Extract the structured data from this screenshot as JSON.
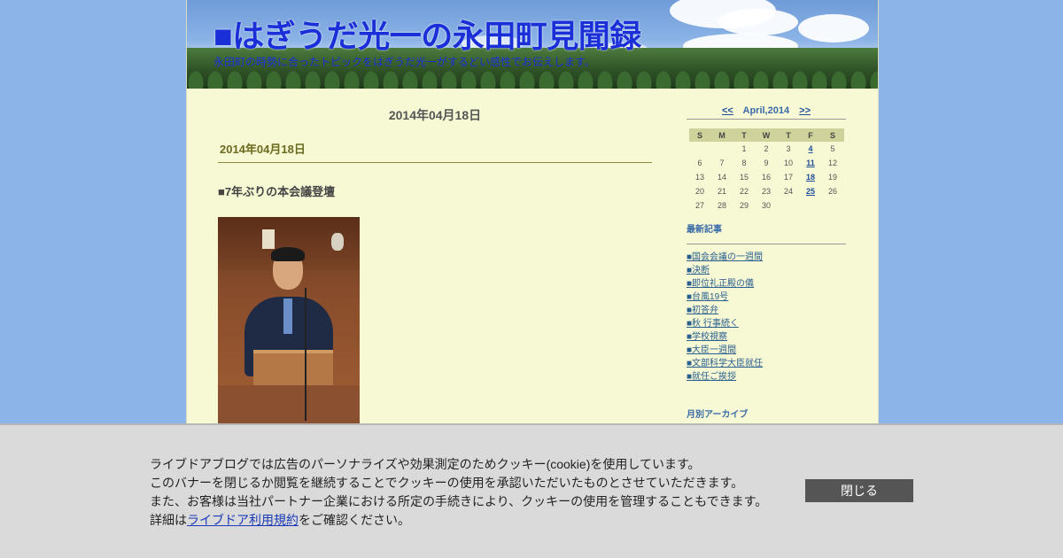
{
  "blog": {
    "title": "■はぎうだ光一の永田町見聞録",
    "description": "永田町の時勢に合ったトピックをはぎうだ光一がするどい感性でお伝えします。"
  },
  "main": {
    "date_heading": "2014年04月18日",
    "entry": {
      "date": "2014年04月18日",
      "title": "■7年ぶりの本会議登壇"
    }
  },
  "sidebar": {
    "calendar": {
      "prev": "<<",
      "month": "April,2014",
      "next": ">>",
      "weekdays": [
        "S",
        "M",
        "T",
        "W",
        "T",
        "F",
        "S"
      ],
      "weeks": [
        [
          "",
          "",
          "1",
          "2",
          "3",
          "4",
          "5"
        ],
        [
          "6",
          "7",
          "8",
          "9",
          "10",
          "11",
          "12"
        ],
        [
          "13",
          "14",
          "15",
          "16",
          "17",
          "18",
          "19"
        ],
        [
          "20",
          "21",
          "22",
          "23",
          "24",
          "25",
          "26"
        ],
        [
          "27",
          "28",
          "29",
          "30",
          "",
          "",
          ""
        ]
      ],
      "linked_days": [
        "4",
        "11",
        "18",
        "25"
      ]
    },
    "recent_title": "最新記事",
    "recent": [
      "■国会会議の一週間",
      "■決断",
      "■即位礼正殿の儀",
      "■台風19号",
      "■初答弁",
      "■秋 行事続く",
      "■学校視察",
      "■大臣一週間",
      "■文部科学大臣就任",
      "■就任ご挨拶"
    ],
    "archive_title": "月別アーカイブ"
  },
  "cookie": {
    "line1": "ライブドアブログでは広告のパーソナライズや効果測定のためクッキー(cookie)を使用しています。",
    "line2": "このバナーを閉じるか閲覧を継続することでクッキーの使用を承認いただいたものとさせていただきます。",
    "line3": "また、お客様は当社パートナー企業における所定の手続きにより、クッキーの使用を管理することもできます。",
    "line4_prefix": "詳細は",
    "line4_link": "ライブドア利用規約",
    "line4_suffix": "をご確認ください。",
    "close_label": "閉じる"
  }
}
